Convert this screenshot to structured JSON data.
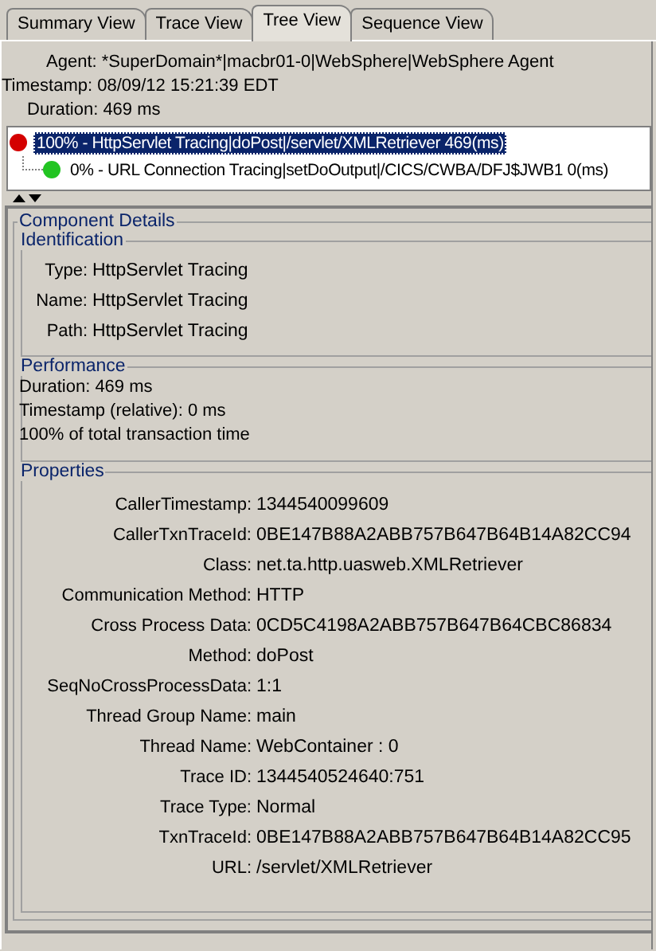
{
  "tabs": [
    {
      "label": "Summary View",
      "selected": false
    },
    {
      "label": "Trace View",
      "selected": false
    },
    {
      "label": "Tree View",
      "selected": true
    },
    {
      "label": "Sequence View",
      "selected": false
    }
  ],
  "header": {
    "agent": "Agent: *SuperDomain*|macbr01-0|WebSphere|WebSphere Agent",
    "timestamp": "Timestamp: 08/09/12 15:21:39 EDT",
    "duration": "Duration: 469 ms"
  },
  "tree": [
    {
      "label": "100% - HttpServlet Tracing|doPost|/servlet/XMLRetriever 469(ms)",
      "color": "#d40000",
      "selected": true,
      "children": [
        {
          "label": "0% - URL Connection Tracing|setDoOutput|/CICS/CWBA/DFJ$JWB1 0(ms)",
          "color": "#22c422",
          "selected": false
        }
      ]
    }
  ],
  "details": {
    "title": "Component Details",
    "identification": {
      "title": "Identification",
      "rows": [
        {
          "label": "Type:",
          "value": "HttpServlet Tracing"
        },
        {
          "label": "Name:",
          "value": "HttpServlet Tracing"
        },
        {
          "label": "Path:",
          "value": "HttpServlet Tracing"
        }
      ]
    },
    "performance": {
      "title": "Performance",
      "lines": [
        "Duration: 469 ms",
        "Timestamp (relative): 0 ms",
        "100% of total transaction time"
      ]
    },
    "properties": {
      "title": "Properties",
      "rows": [
        {
          "label": "CallerTimestamp:",
          "value": "1344540099609"
        },
        {
          "label": "CallerTxnTraceId:",
          "value": "0BE147B88A2ABB757B647B64B14A82CC94"
        },
        {
          "label": "Class:",
          "value": "net.ta.http.uasweb.XMLRetriever"
        },
        {
          "label": "Communication Method:",
          "value": "HTTP"
        },
        {
          "label": "Cross Process Data:",
          "value": "0CD5C4198A2ABB757B647B64CBC86834"
        },
        {
          "label": "Method:",
          "value": "doPost"
        },
        {
          "label": "SeqNoCrossProcessData:",
          "value": "1:1"
        },
        {
          "label": "Thread Group Name:",
          "value": "main"
        },
        {
          "label": "Thread Name:",
          "value": "WebContainer : 0"
        },
        {
          "label": "Trace ID:",
          "value": "1344540524640:751"
        },
        {
          "label": "Trace Type:",
          "value": "Normal"
        },
        {
          "label": "TxnTraceId:",
          "value": "0BE147B88A2ABB757B647B64B14A82CC95"
        },
        {
          "label": "URL:",
          "value": "/servlet/XMLRetriever"
        }
      ]
    }
  }
}
